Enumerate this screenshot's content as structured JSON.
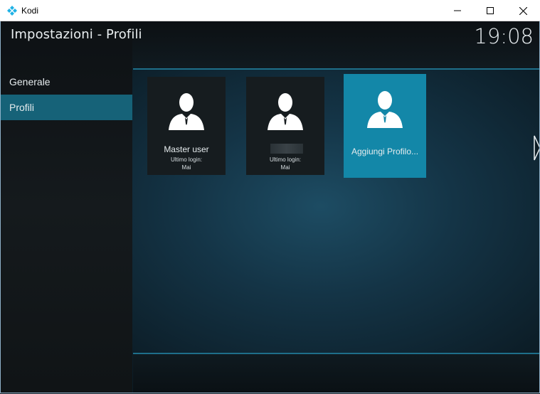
{
  "window": {
    "title": "Kodi",
    "minimize_icon": "minimize-icon",
    "maximize_icon": "maximize-icon",
    "close_icon": "close-icon"
  },
  "header": {
    "title": "Impostazioni - Profili",
    "clock": "19:08"
  },
  "sidebar": {
    "items": [
      {
        "label": "Generale",
        "active": false
      },
      {
        "label": "Profili",
        "active": true
      }
    ]
  },
  "profiles": [
    {
      "name": "Master user",
      "last_login_label": "Ultimo login:",
      "last_login_value": "Mai",
      "icon": "user-icon"
    },
    {
      "name": "",
      "name_obscured": true,
      "last_login_label": "Ultimo login:",
      "last_login_value": "Mai",
      "icon": "user-icon"
    },
    {
      "name": "Aggiungi Profilo...",
      "focused": true,
      "icon": "user-icon"
    }
  ],
  "colors": {
    "accent": "#1387a8",
    "sidebar_active": "#166278",
    "divider": "#1e6f8a"
  }
}
